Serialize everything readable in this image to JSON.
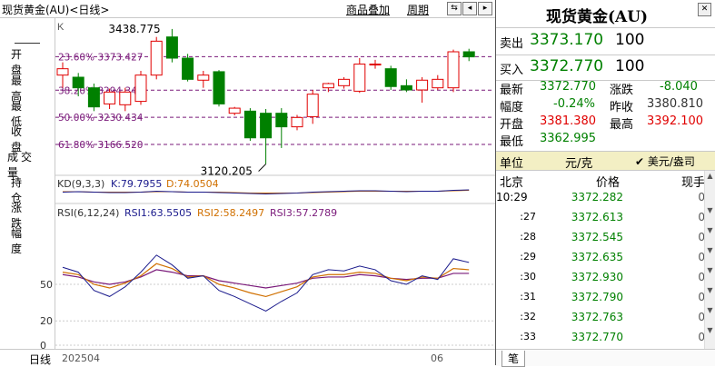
{
  "toolbar": {
    "title": "现货黄金(AU)<日线>",
    "overlay_label": "商品叠加",
    "period_label": "周期"
  },
  "left_panel": {
    "labels": [
      "开盘",
      "最高",
      "最低",
      "收盘",
      "成交量",
      "持仓",
      "涨跌",
      "幅度"
    ],
    "bottom_label": "日线"
  },
  "chart_main": {
    "k_label": "K",
    "high_label": "3438.775",
    "low_label": "3120.205",
    "fib_levels": [
      {
        "text": "23.60% 3373.427",
        "price": 3373.427
      },
      {
        "text": "38.20% 3294.347",
        "price": 3294.347
      },
      {
        "text": "50.00% 3230.434",
        "price": 3230.434
      },
      {
        "text": "61.80% 3166.520",
        "price": 3166.52
      }
    ]
  },
  "kd": {
    "name": "KD(9,3,3)",
    "k": "K:79.7955",
    "d": "D:74.0504",
    "k_color": "#1a1a8c",
    "d_color": "#d07000"
  },
  "rsi": {
    "name": "RSI(6,12,24)",
    "rsi1": "RSI1:63.5505",
    "rsi2": "RSI2:58.2497",
    "rsi3": "RSI3:57.2789",
    "axis": [
      "50",
      "20",
      "0"
    ]
  },
  "x_axis": {
    "left": "202504",
    "right": "06"
  },
  "chart_data": {
    "type": "candlestick",
    "candles": [
      {
        "o": 3330,
        "h": 3360,
        "l": 3300,
        "c": 3345
      },
      {
        "o": 3325,
        "h": 3335,
        "l": 3280,
        "c": 3300
      },
      {
        "o": 3300,
        "h": 3310,
        "l": 3245,
        "c": 3255
      },
      {
        "o": 3262,
        "h": 3298,
        "l": 3250,
        "c": 3290
      },
      {
        "o": 3260,
        "h": 3300,
        "l": 3245,
        "c": 3290
      },
      {
        "o": 3268,
        "h": 3340,
        "l": 3260,
        "c": 3330
      },
      {
        "o": 3330,
        "h": 3420,
        "l": 3320,
        "c": 3410
      },
      {
        "o": 3420,
        "h": 3438.775,
        "l": 3360,
        "c": 3370
      },
      {
        "o": 3370,
        "h": 3380,
        "l": 3315,
        "c": 3320
      },
      {
        "o": 3318,
        "h": 3340,
        "l": 3300,
        "c": 3330
      },
      {
        "o": 3338,
        "h": 3342,
        "l": 3256,
        "c": 3262
      },
      {
        "o": 3240,
        "h": 3255,
        "l": 3235,
        "c": 3252
      },
      {
        "o": 3245,
        "h": 3252,
        "l": 3175,
        "c": 3182
      },
      {
        "o": 3240,
        "h": 3250,
        "l": 3120.205,
        "c": 3182
      },
      {
        "o": 3240,
        "h": 3252,
        "l": 3158,
        "c": 3208
      },
      {
        "o": 3208,
        "h": 3236,
        "l": 3200,
        "c": 3230
      },
      {
        "o": 3232,
        "h": 3295,
        "l": 3215,
        "c": 3285
      },
      {
        "o": 3300,
        "h": 3312,
        "l": 3290,
        "c": 3310
      },
      {
        "o": 3305,
        "h": 3325,
        "l": 3298,
        "c": 3320
      },
      {
        "o": 3292,
        "h": 3370,
        "l": 3288,
        "c": 3356
      },
      {
        "o": 3356,
        "h": 3366,
        "l": 3345,
        "c": 3356
      },
      {
        "o": 3345,
        "h": 3352,
        "l": 3295,
        "c": 3303
      },
      {
        "o": 3305,
        "h": 3320,
        "l": 3290,
        "c": 3295
      },
      {
        "o": 3295,
        "h": 3325,
        "l": 3265,
        "c": 3318
      },
      {
        "o": 3300,
        "h": 3330,
        "l": 3295,
        "c": 3320
      },
      {
        "o": 3300,
        "h": 3390,
        "l": 3290,
        "c": 3385
      },
      {
        "o": 3385,
        "h": 3392.1,
        "l": 3362.995,
        "c": 3373
      }
    ],
    "rsi_ylim": [
      0,
      100
    ],
    "rsi1": [
      64,
      60,
      45,
      40,
      48,
      60,
      74,
      66,
      55,
      57,
      45,
      40,
      34,
      28,
      36,
      43,
      58,
      62,
      61,
      65,
      62,
      53,
      50,
      57,
      54,
      71,
      68
    ],
    "rsi2": [
      60,
      58,
      50,
      47,
      51,
      57,
      67,
      63,
      56,
      57,
      50,
      47,
      43,
      40,
      44,
      48,
      56,
      58,
      58,
      60,
      59,
      55,
      53,
      56,
      55,
      63,
      62
    ],
    "rsi3": [
      58,
      56,
      52,
      50,
      52,
      56,
      62,
      60,
      57,
      57,
      53,
      51,
      49,
      47,
      49,
      51,
      55,
      56,
      56,
      58,
      57,
      55,
      54,
      55,
      55,
      59,
      59
    ],
    "kd_k": [
      55,
      56,
      55,
      54,
      54,
      55,
      57,
      56,
      55,
      55,
      54,
      53,
      52,
      51,
      52,
      53,
      55,
      56,
      57,
      58,
      58,
      57,
      56,
      57,
      57,
      59,
      60
    ],
    "kd_d": [
      56,
      56,
      55,
      55,
      55,
      55,
      56,
      56,
      55,
      55,
      55,
      54,
      53,
      53,
      53,
      53,
      54,
      55,
      56,
      57,
      57,
      57,
      57,
      57,
      57,
      58,
      59
    ]
  },
  "quote": {
    "title": "现货黄金(AU)",
    "ask_label": "卖出",
    "ask_price": "3373.170",
    "ask_vol": "100",
    "bid_label": "买入",
    "bid_price": "3372.770",
    "bid_vol": "100",
    "stats": {
      "latest_label": "最新",
      "latest": "3372.770",
      "change_label": "涨跌",
      "change": "-8.040",
      "pct_label": "幅度",
      "pct": "-0.24%",
      "prev_label": "昨收",
      "prev": "3380.810",
      "open_label": "开盘",
      "open": "3381.380",
      "high_label": "最高",
      "high": "3392.100",
      "low_label": "最低",
      "low": "3362.995"
    },
    "unit_label": "单位",
    "unit_value": "元/克",
    "currency_label": "✔ 美元/盎司",
    "ticks_header": {
      "place": "北京",
      "price": "价格",
      "vol": "现手"
    },
    "ticks": [
      {
        "time": "10:29",
        "price": "3372.282",
        "vol": "0"
      },
      {
        "time": ":27",
        "price": "3372.613",
        "vol": "0"
      },
      {
        "time": ":28",
        "price": "3372.545",
        "vol": "0"
      },
      {
        "time": ":29",
        "price": "3372.635",
        "vol": "0"
      },
      {
        "time": ":30",
        "price": "3372.930",
        "vol": "0"
      },
      {
        "time": ":31",
        "price": "3372.790",
        "vol": "0"
      },
      {
        "time": ":32",
        "price": "3372.763",
        "vol": "0"
      },
      {
        "time": ":33",
        "price": "3372.770",
        "vol": "0"
      }
    ],
    "tab_label": "笔"
  }
}
